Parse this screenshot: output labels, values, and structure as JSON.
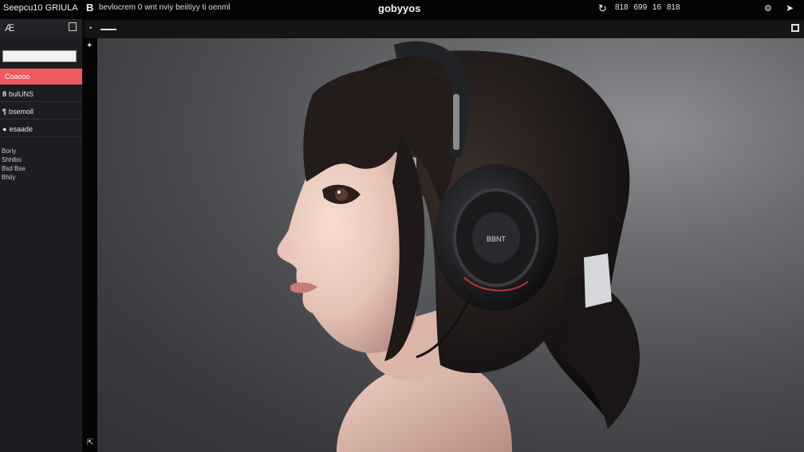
{
  "topbar": {
    "brand": "Seepcu10 GRIULA",
    "brand_mark": "B",
    "subtitle": "bevlocrem 0 wnt nviy beiitiyy ti oenml",
    "center_title": "gobyyos",
    "refresh_icon": "refresh-icon",
    "stats": "818 699 16 818",
    "gear_icon": "gear-icon",
    "share_icon": "share-icon"
  },
  "toolbar2": {
    "dot": "•"
  },
  "sidebar": {
    "logo": "Æ",
    "search_value": "",
    "items": [
      {
        "icon": "",
        "label": "Coaooo",
        "active": true
      },
      {
        "icon": "8",
        "label": "bulUNS",
        "active": false
      },
      {
        "icon": "¶",
        "label": "bsemoll",
        "active": false
      },
      {
        "icon": "●",
        "label": "esaade",
        "active": false
      }
    ],
    "meta": [
      "Boriy",
      "Shhlbo",
      "Bsd Bse",
      "Bhiiy"
    ]
  },
  "viewer": {
    "image": "anime-girl-with-headphones",
    "headphone_label": "BBNT"
  },
  "colors": {
    "accent": "#ef5a5f",
    "background": "#0b0b0c",
    "sidebar": "#1c1d20"
  }
}
